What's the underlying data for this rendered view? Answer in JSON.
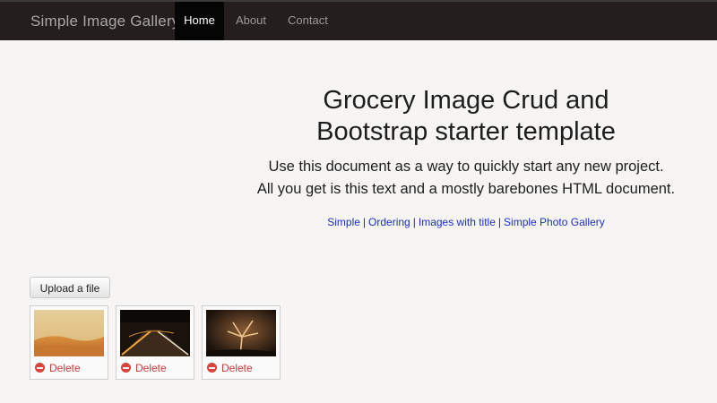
{
  "navbar": {
    "brand": "Simple Image Gallery",
    "items": [
      {
        "label": "Home",
        "active": true
      },
      {
        "label": "About",
        "active": false
      },
      {
        "label": "Contact",
        "active": false
      }
    ]
  },
  "hero": {
    "title_line1": "Grocery Image Crud and",
    "title_line2": "Bootstrap starter template",
    "lead_line1": "Use this document as a way to quickly start any new project.",
    "lead_line2": "All you get is this text and a mostly barebones HTML document.",
    "links": [
      {
        "label": "Simple"
      },
      {
        "label": "Ordering"
      },
      {
        "label": "Images with title"
      },
      {
        "label": "Simple Photo Gallery"
      }
    ],
    "separator": "|"
  },
  "gallery": {
    "upload_label": "Upload a file",
    "items": [
      {
        "delete_label": "Delete"
      },
      {
        "delete_label": "Delete"
      },
      {
        "delete_label": "Delete"
      }
    ]
  },
  "colors": {
    "navbar_bg": "#241e1c",
    "link": "#1b2fc4",
    "delete": "#c8403a"
  }
}
